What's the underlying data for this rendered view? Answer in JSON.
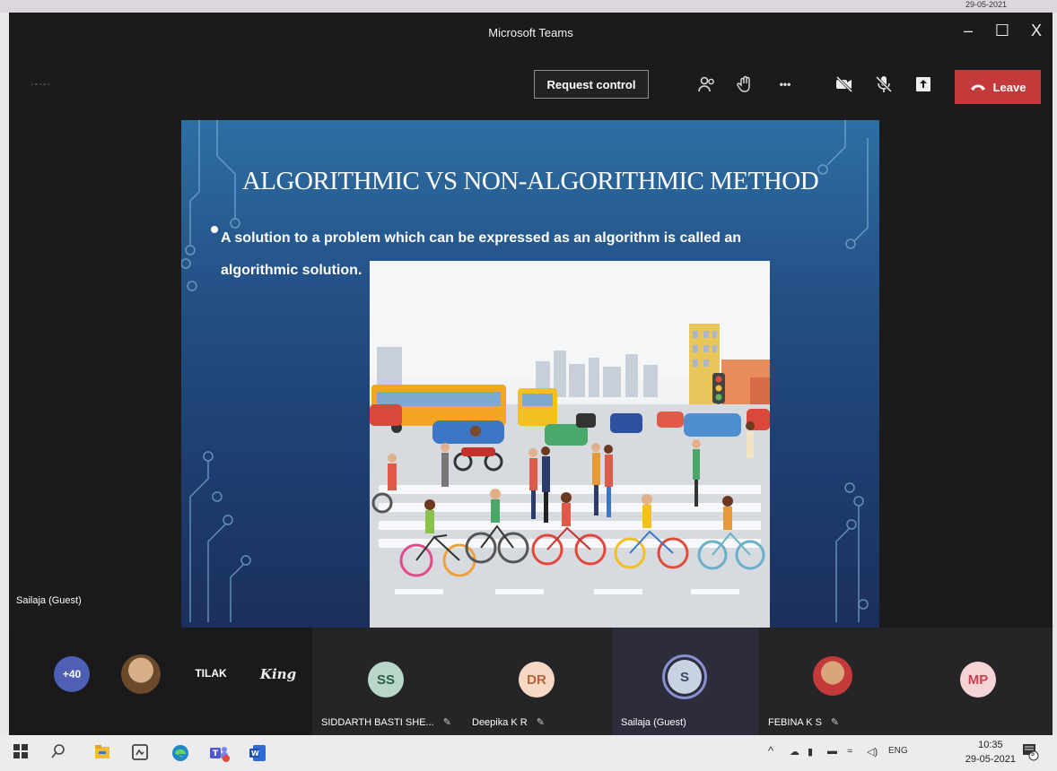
{
  "window": {
    "title": "Microsoft Teams",
    "controls": {
      "minimize": "–",
      "maximize": "☐",
      "close": "X"
    }
  },
  "toolbar": {
    "request_control_label": "Request control",
    "more_label": "•••",
    "leave_label": "Leave",
    "icons": [
      "people-icon",
      "reactions-icon",
      "more-icon",
      "camera-off-icon",
      "mic-off-icon",
      "share-icon",
      "phone-icon"
    ]
  },
  "slide": {
    "title": "ALGORITHMIC VS NON-ALGORITHMIC METHOD",
    "bullet_line1": "A solution to a problem which can be expressed as an algorithm is called an",
    "bullet_line2": "algorithmic solution.",
    "image_subject": "busy street crossing with cyclists and traffic"
  },
  "presenter_name": "Sailaja (Guest)",
  "participants": [
    {
      "initials": "+40",
      "color": "#4e5fb5",
      "name": ""
    },
    {
      "initials": "",
      "color": "#9a7a5a",
      "name": ""
    },
    {
      "initials": "TILAK",
      "color": "#1a191b",
      "name": ""
    },
    {
      "initials": "King",
      "color": "#1a191b",
      "name": ""
    },
    {
      "initials": "SS",
      "color": "#b8d7c8",
      "name": "SIDDARTH BASTI SHE..."
    },
    {
      "initials": "DR",
      "color": "#f6d9c5",
      "name": "Deepika K R"
    },
    {
      "initials": "S",
      "color": "#c9d2e0",
      "name": "Sailaja (Guest)"
    },
    {
      "initials": "",
      "color": "#d46a6a",
      "name": "FEBINA K S"
    },
    {
      "initials": "MP",
      "color": "#f6d3d6",
      "name": ""
    }
  ],
  "taskbar": {
    "apps": [
      "windows-icon",
      "search-icon",
      "file-explorer-icon",
      "snip-icon",
      "edge-icon",
      "teams-icon",
      "word-icon"
    ],
    "tray_language": "ENG",
    "time": "10:35",
    "date": "29-05-2021",
    "notification_count": "5"
  },
  "colors": {
    "leave": "#c43a3a",
    "slide_top": "#2d6fa3",
    "slide_bottom": "#1c2f5c",
    "window_bg": "#1b1a1c"
  }
}
